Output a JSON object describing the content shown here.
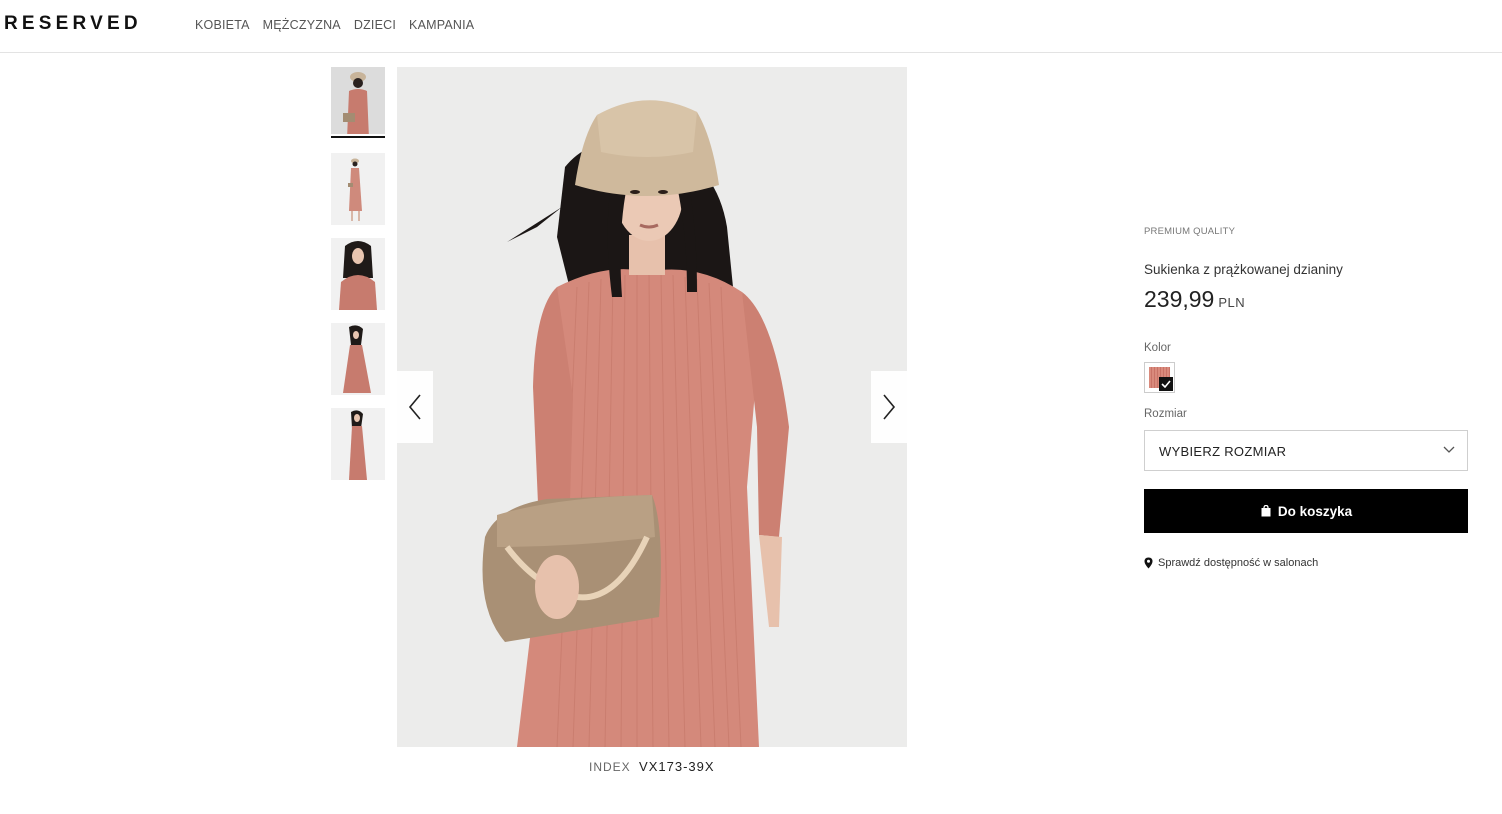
{
  "header": {
    "logo": "RESERVED",
    "nav": [
      "KOBIETA",
      "MĘŻCZYZNA",
      "DZIECI",
      "KAMPANIA"
    ]
  },
  "gallery": {
    "thumbnail_count": 5,
    "active_thumbnail": 0,
    "prev_icon": "chevron-left-icon",
    "next_icon": "chevron-right-icon"
  },
  "product": {
    "quality_tag": "PREMIUM QUALITY",
    "name": "Sukienka z prążkowanej dzianiny",
    "price": "239,99",
    "currency": "PLN",
    "color_label": "Kolor",
    "selected_color": "#d4897b",
    "size_label": "Rozmiar",
    "size_placeholder": "WYBIERZ ROZMIAR",
    "add_to_cart": "Do koszyka",
    "store_availability": "Sprawdź dostępność w salonach",
    "index_label": "INDEX",
    "index_value": "VX173-39X"
  },
  "colors": {
    "button_bg": "#000000",
    "dress": "#d4897b",
    "background": "#ececeb"
  }
}
